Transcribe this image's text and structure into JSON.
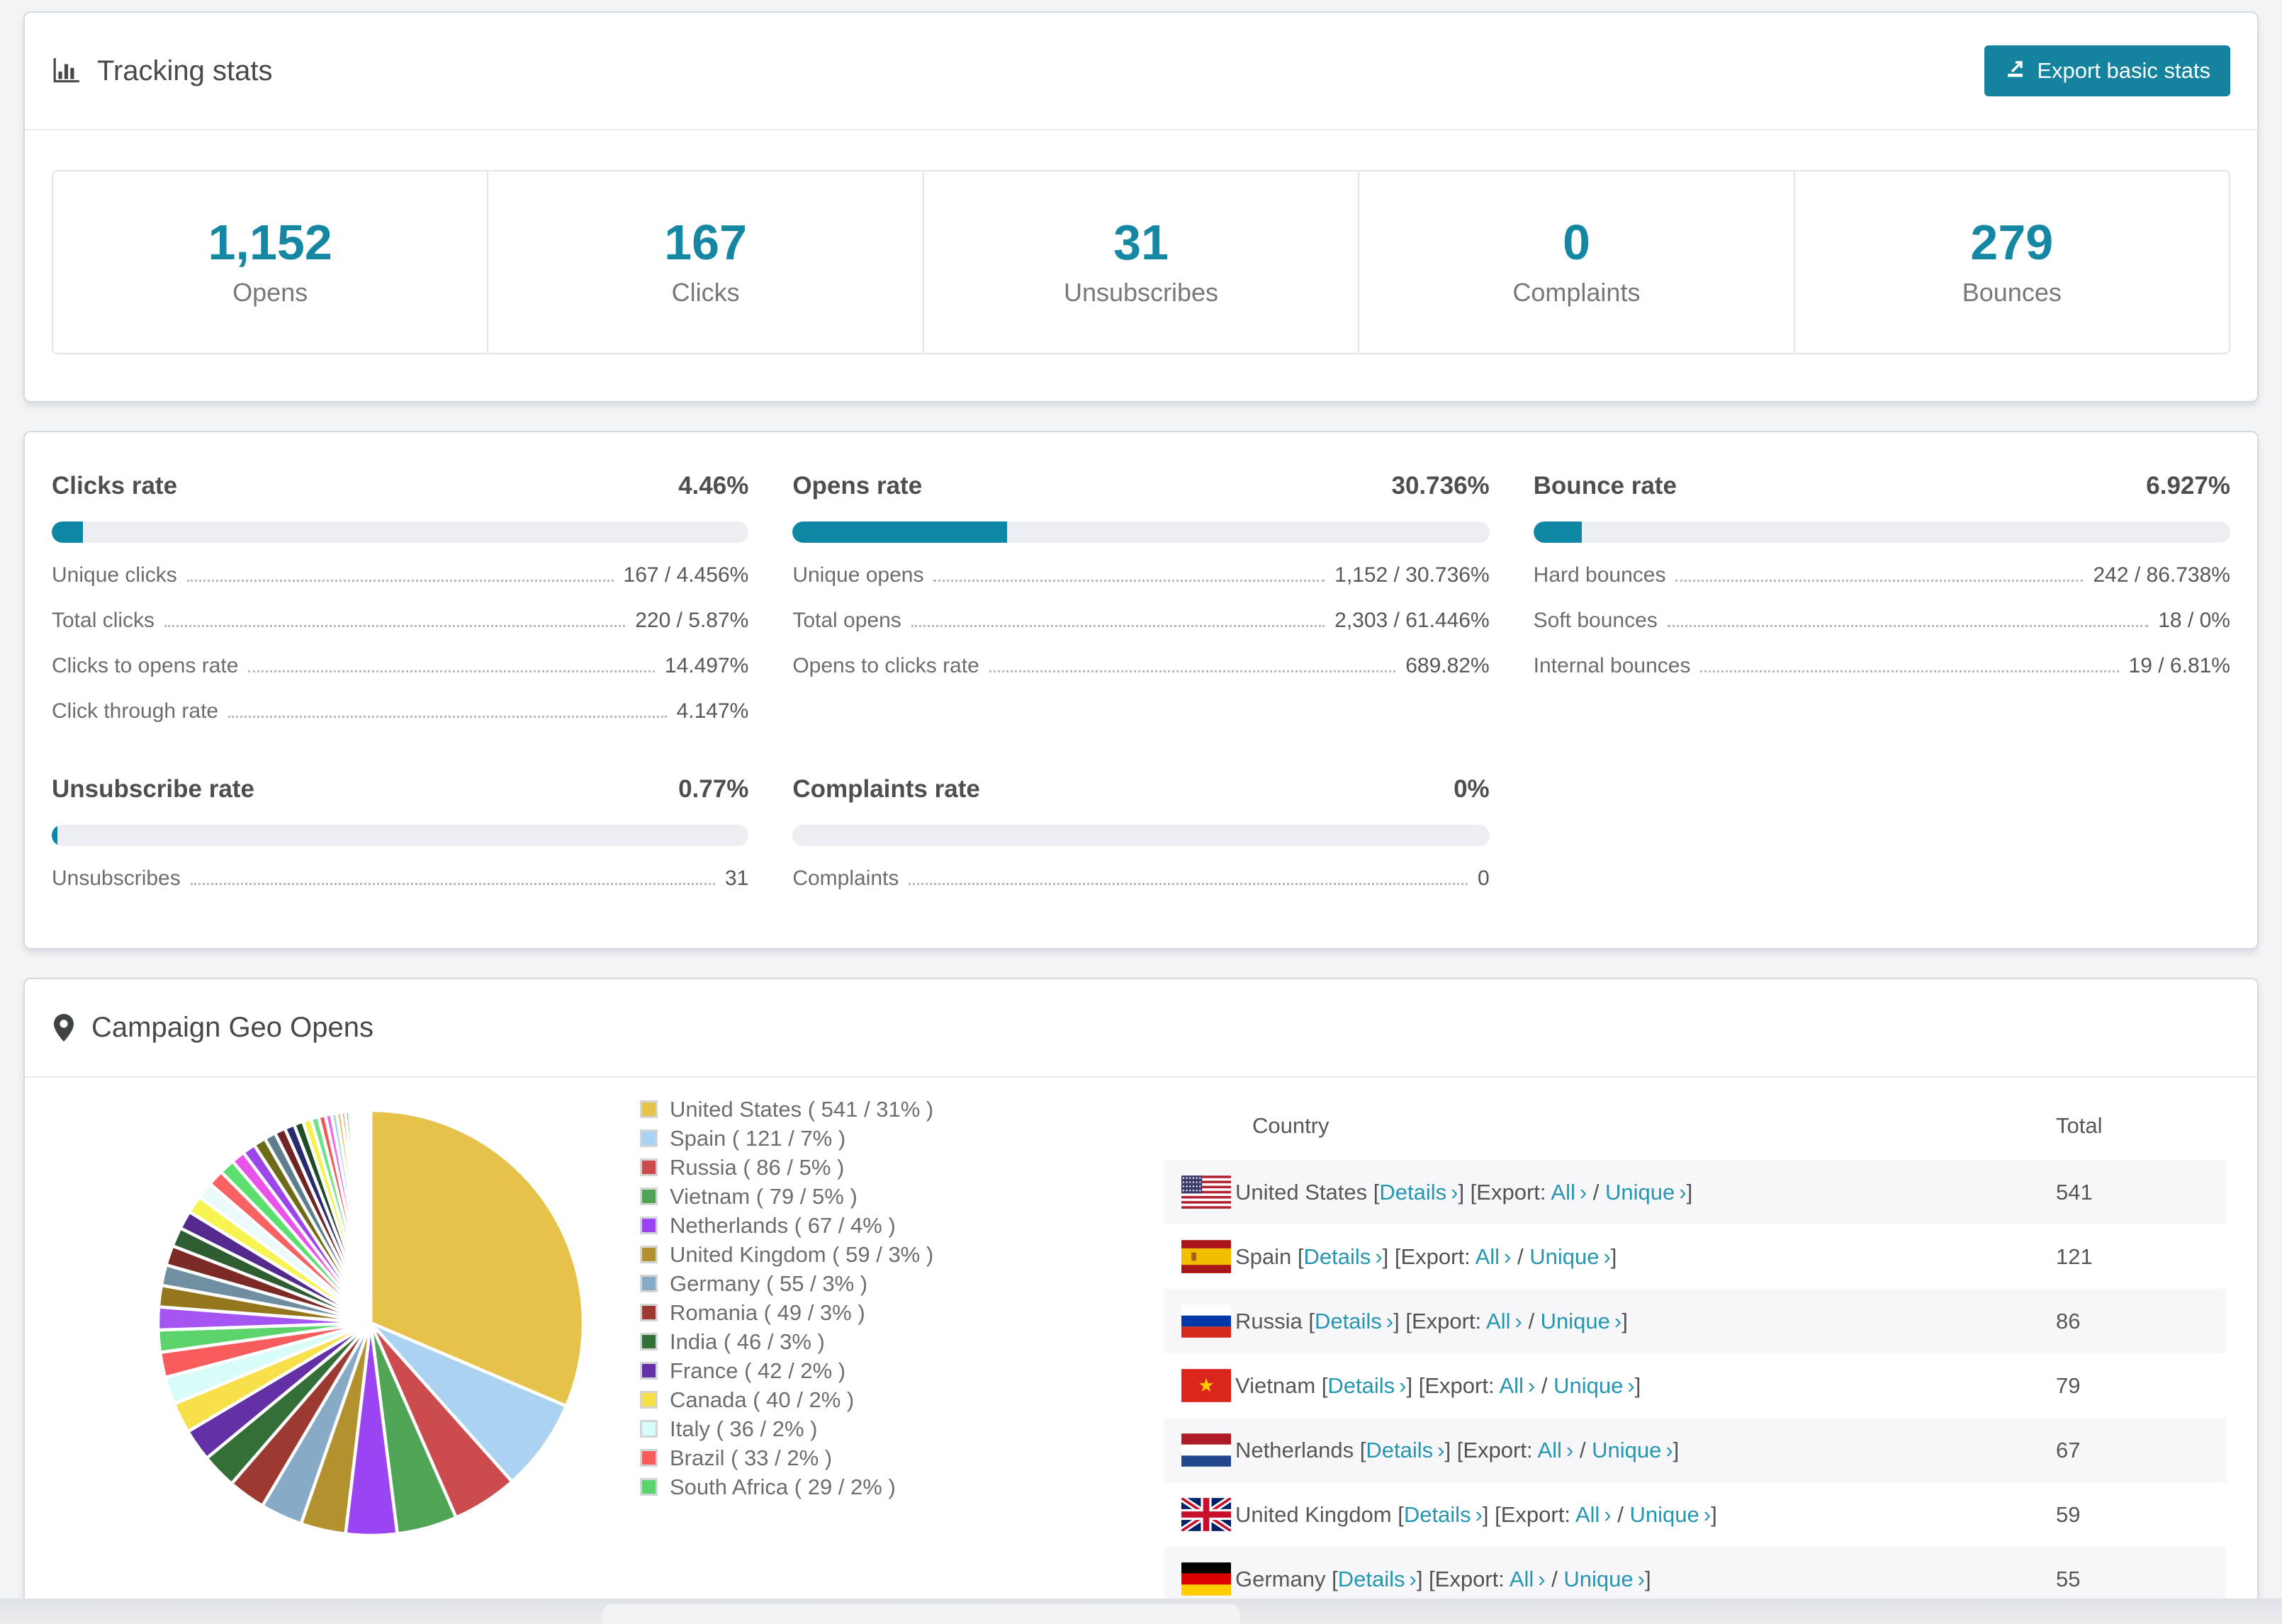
{
  "tracking": {
    "title": "Tracking stats",
    "export_button": "Export basic stats",
    "stats": [
      {
        "value": "1,152",
        "label": "Opens"
      },
      {
        "value": "167",
        "label": "Clicks"
      },
      {
        "value": "31",
        "label": "Unsubscribes"
      },
      {
        "value": "0",
        "label": "Complaints"
      },
      {
        "value": "279",
        "label": "Bounces"
      }
    ]
  },
  "rates": {
    "panels": [
      {
        "title": "Clicks rate",
        "value": "4.46%",
        "progress_pct": 4.46,
        "rows": [
          {
            "label": "Unique clicks",
            "value": "167 / 4.456%"
          },
          {
            "label": "Total clicks",
            "value": "220 / 5.87%"
          },
          {
            "label": "Clicks to opens rate",
            "value": "14.497%"
          },
          {
            "label": "Click through rate",
            "value": "4.147%"
          }
        ]
      },
      {
        "title": "Opens rate",
        "value": "30.736%",
        "progress_pct": 30.736,
        "rows": [
          {
            "label": "Unique opens",
            "value": "1,152 / 30.736%"
          },
          {
            "label": "Total opens",
            "value": "2,303 / 61.446%"
          },
          {
            "label": "Opens to clicks rate",
            "value": "689.82%"
          }
        ]
      },
      {
        "title": "Bounce rate",
        "value": "6.927%",
        "progress_pct": 6.927,
        "rows": [
          {
            "label": "Hard bounces",
            "value": "242 / 86.738%"
          },
          {
            "label": "Soft bounces",
            "value": "18 / 0%"
          },
          {
            "label": "Internal bounces",
            "value": "19 / 6.81%"
          }
        ]
      },
      {
        "title": "Unsubscribe rate",
        "value": "0.77%",
        "progress_pct": 0.77,
        "rows": [
          {
            "label": "Unsubscribes",
            "value": "31"
          }
        ]
      },
      {
        "title": "Complaints rate",
        "value": "0%",
        "progress_pct": 0,
        "rows": [
          {
            "label": "Complaints",
            "value": "0"
          }
        ]
      }
    ]
  },
  "geo": {
    "title": "Campaign Geo Opens",
    "table": {
      "headers": {
        "country": "Country",
        "total": "Total"
      },
      "link_details": "Details",
      "export_label": "Export:",
      "link_all": "All",
      "link_unique": "Unique",
      "chevron": "›",
      "punct": {
        "open": "[",
        "close": "]",
        "slash": "/"
      },
      "rows": [
        {
          "flag": "us",
          "country": "United States",
          "total": "541"
        },
        {
          "flag": "es",
          "country": "Spain",
          "total": "121"
        },
        {
          "flag": "ru",
          "country": "Russia",
          "total": "86"
        },
        {
          "flag": "vn",
          "country": "Vietnam",
          "total": "79"
        },
        {
          "flag": "nl",
          "country": "Netherlands",
          "total": "67"
        },
        {
          "flag": "gb",
          "country": "United Kingdom",
          "total": "59"
        },
        {
          "flag": "de",
          "country": "Germany",
          "total": "55"
        }
      ]
    }
  },
  "chart_data": {
    "type": "pie",
    "title": "Campaign Geo Opens",
    "start": "top",
    "direction": "clockwise",
    "legend_position": "right",
    "series": [
      {
        "label": "United States",
        "value": 541,
        "pct": "31%",
        "color": "#e7c24b"
      },
      {
        "label": "Spain",
        "value": 121,
        "pct": "7%",
        "color": "#abd3f1"
      },
      {
        "label": "Russia",
        "value": 86,
        "pct": "5%",
        "color": "#cc4b4e"
      },
      {
        "label": "Vietnam",
        "value": 79,
        "pct": "5%",
        "color": "#4fa555"
      },
      {
        "label": "Netherlands",
        "value": 67,
        "pct": "4%",
        "color": "#9b44f2"
      },
      {
        "label": "United Kingdom",
        "value": 59,
        "pct": "3%",
        "color": "#b3912f"
      },
      {
        "label": "Germany",
        "value": 55,
        "pct": "3%",
        "color": "#87aac6"
      },
      {
        "label": "Romania",
        "value": 49,
        "pct": "3%",
        "color": "#9c3a32"
      },
      {
        "label": "India",
        "value": 46,
        "pct": "3%",
        "color": "#336f36"
      },
      {
        "label": "France",
        "value": 42,
        "pct": "2%",
        "color": "#6430a5"
      },
      {
        "label": "Canada",
        "value": 40,
        "pct": "2%",
        "color": "#f8e04b"
      },
      {
        "label": "Italy",
        "value": 36,
        "pct": "2%",
        "color": "#d8fcf8"
      },
      {
        "label": "Brazil",
        "value": 33,
        "pct": "2%",
        "color": "#f75d5d"
      },
      {
        "label": "South Africa",
        "value": 29,
        "pct": "2%",
        "color": "#5dd36b"
      }
    ],
    "others_unlabeled_estimated": {
      "values": [
        30,
        28,
        27,
        26,
        25,
        24,
        23,
        22,
        21,
        20,
        18,
        17,
        16,
        15,
        14,
        13,
        12,
        11,
        10,
        9,
        8,
        7,
        6,
        5,
        5,
        4,
        4,
        3,
        3,
        2,
        2,
        2,
        1,
        1,
        1,
        1,
        1,
        1,
        1,
        1
      ],
      "colors": [
        "#a455f2",
        "#94761d",
        "#6f8fa0",
        "#7c2a26",
        "#2f5d31",
        "#542a8e",
        "#f7f451",
        "#ecf9fa",
        "#f96262",
        "#5ddf70",
        "#e953e9",
        "#9b45ea",
        "#6f6a17",
        "#5e7e8e",
        "#702424",
        "#2a2a70",
        "#1f4b29",
        "#f4f152",
        "#6de287",
        "#f25858",
        "#ef6ce3",
        "#a7d3f5",
        "#d7b73d",
        "#d04a4a",
        "#4ca757",
        "#8549e9",
        "#caa53b",
        "#ef8ce0",
        "#b9dcf8",
        "#e3c348",
        "#57b15f",
        "#9254ec",
        "#d65252",
        "#a1cdef",
        "#dcc145",
        "#59ab5d",
        "#9659ee",
        "#cc4d4d",
        "#99c7ed",
        "#e1bf41"
      ]
    }
  }
}
